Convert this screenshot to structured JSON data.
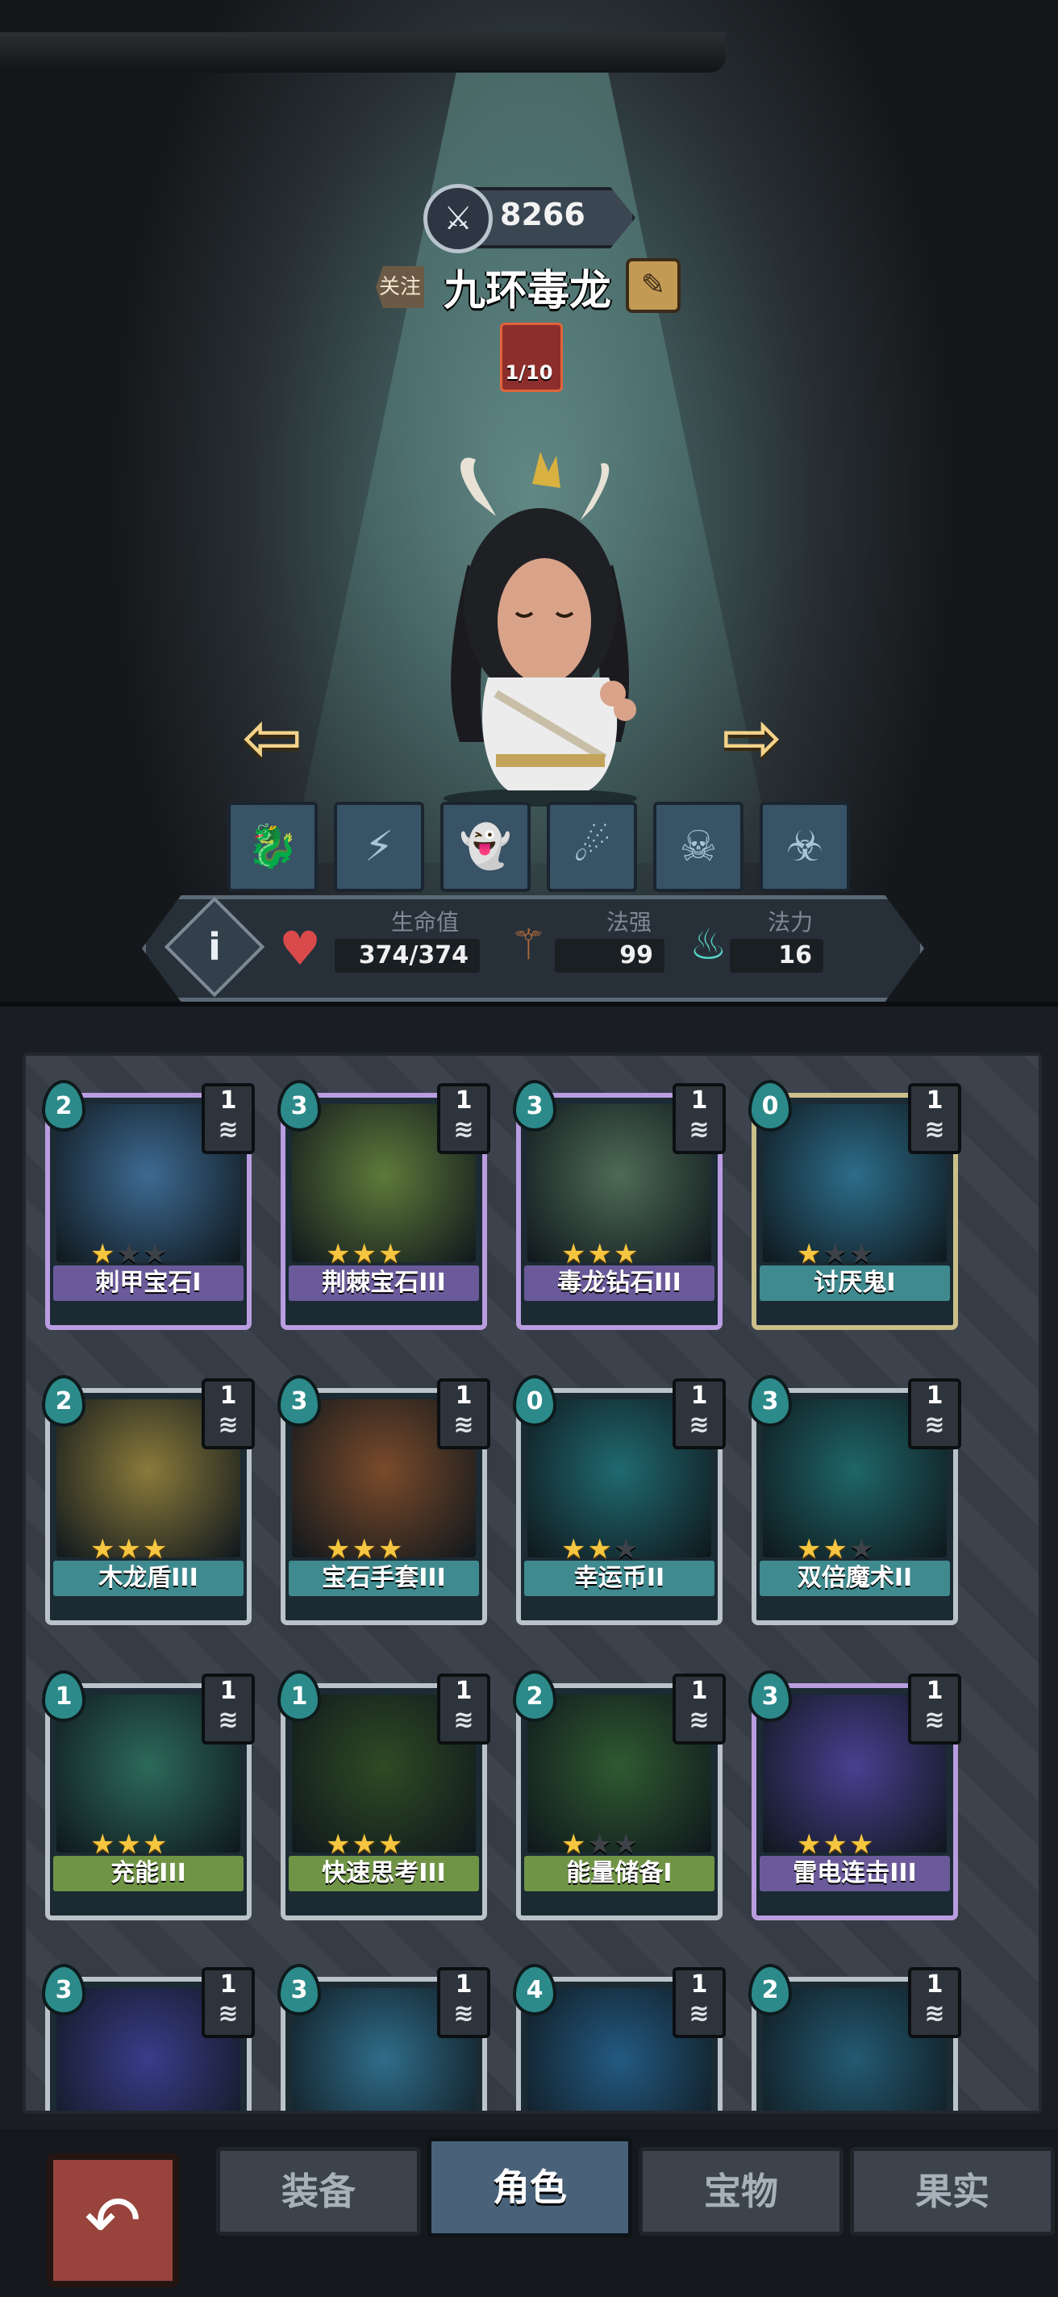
{
  "header": {
    "score": "8266",
    "follow_label": "关注",
    "player_name": "九环毒龙",
    "badge_text": "1/10"
  },
  "skills": [
    "dragon-icon",
    "claw-icon",
    "ghost-book-icon",
    "tentacle-icon",
    "skull-icon",
    "poison-figure-icon"
  ],
  "stats": {
    "hp_label": "生命值",
    "hp_value": "374/374",
    "spell_power_label": "法强",
    "spell_power_value": "99",
    "mana_label": "法力",
    "mana_value": "16"
  },
  "cards": [
    {
      "name": "刺甲宝石I",
      "cost": "2",
      "level": "1",
      "stars": 1,
      "rarity": "purple",
      "color": "#3d6a92"
    },
    {
      "name": "荆棘宝石III",
      "cost": "3",
      "level": "1",
      "stars": 3,
      "rarity": "purple",
      "color": "#5f7a3a"
    },
    {
      "name": "毒龙钻石III",
      "cost": "3",
      "level": "1",
      "stars": 3,
      "rarity": "purple",
      "color": "#4e6b55"
    },
    {
      "name": "讨厌鬼I",
      "cost": "0",
      "level": "1",
      "stars": 1,
      "rarity": "gold",
      "color": "#2c6d8a"
    },
    {
      "name": "木龙盾III",
      "cost": "2",
      "level": "1",
      "stars": 3,
      "rarity": "normal",
      "color": "#8a7a3a"
    },
    {
      "name": "宝石手套III",
      "cost": "3",
      "level": "1",
      "stars": 3,
      "rarity": "normal",
      "color": "#7a4a2a"
    },
    {
      "name": "幸运币II",
      "cost": "0",
      "level": "1",
      "stars": 2,
      "rarity": "normal",
      "color": "#1f6a70"
    },
    {
      "name": "双倍魔术II",
      "cost": "3",
      "level": "1",
      "stars": 2,
      "rarity": "normal",
      "color": "#1e6668"
    },
    {
      "name": "充能III",
      "cost": "1",
      "level": "1",
      "stars": 3,
      "rarity": "normal",
      "color": "#2c6a5a"
    },
    {
      "name": "快速思考III",
      "cost": "1",
      "level": "1",
      "stars": 3,
      "rarity": "normal",
      "color": "#2f4a24"
    },
    {
      "name": "能量储备I",
      "cost": "2",
      "level": "1",
      "stars": 1,
      "rarity": "normal",
      "color": "#2f5a30"
    },
    {
      "name": "雷电连击III",
      "cost": "3",
      "level": "1",
      "stars": 3,
      "rarity": "purple",
      "color": "#4a3f90"
    },
    {
      "name": "",
      "cost": "3",
      "level": "1",
      "stars": 0,
      "rarity": "normal",
      "color": "#3a3c8a"
    },
    {
      "name": "",
      "cost": "3",
      "level": "1",
      "stars": 0,
      "rarity": "normal",
      "color": "#2f6d8a"
    },
    {
      "name": "",
      "cost": "4",
      "level": "1",
      "stars": 0,
      "rarity": "normal",
      "color": "#235a82"
    },
    {
      "name": "",
      "cost": "2",
      "level": "1",
      "stars": 0,
      "rarity": "normal",
      "color": "#235a72"
    }
  ],
  "tabs": {
    "equipment": "装备",
    "character": "角色",
    "treasure": "宝物",
    "fruit": "果实"
  },
  "colors": {
    "green_nameplate": "#6f9445",
    "purple_nameplate": "#6a5a9a",
    "teal_nameplate": "#3f8a8e"
  }
}
